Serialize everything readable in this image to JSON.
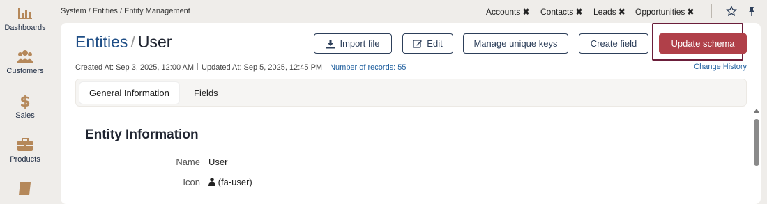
{
  "sidebar": {
    "items": [
      {
        "label": "Dashboards",
        "icon": "bar-chart-icon"
      },
      {
        "label": "Customers",
        "icon": "users-icon"
      },
      {
        "label": "Sales",
        "icon": "dollar-icon"
      },
      {
        "label": "Products",
        "icon": "briefcase-icon"
      },
      {
        "label": "",
        "icon": "book-icon"
      }
    ]
  },
  "topbar": {
    "breadcrumb": "System / Entities / Entity Management",
    "open_tabs": [
      {
        "label": "Accounts",
        "close": "✖"
      },
      {
        "label": "Contacts",
        "close": "✖"
      },
      {
        "label": "Leads",
        "close": "✖"
      },
      {
        "label": "Opportunities",
        "close": "✖"
      }
    ]
  },
  "header": {
    "title_link": "Entities",
    "title_sep": "/",
    "title_current": "User"
  },
  "actions": {
    "import": "Import file",
    "edit": "Edit",
    "unique_keys": "Manage unique keys",
    "create_field": "Create field",
    "update_schema": "Update schema"
  },
  "meta": {
    "created": "Created At: Sep 3, 2025, 12:00 AM",
    "updated": "Updated At: Sep 5, 2025, 12:45 PM",
    "records": "Number of records: 55",
    "history": "Change History"
  },
  "tabs": [
    {
      "label": "General Information",
      "active": true
    },
    {
      "label": "Fields",
      "active": false
    }
  ],
  "section": {
    "title": "Entity Information",
    "fields": [
      {
        "label": "Name",
        "value": "User"
      },
      {
        "label": "Icon",
        "value": "(fa-user)"
      }
    ]
  },
  "colors": {
    "primary": "#b04049",
    "link": "#1f4e86",
    "nav_icon": "#b5885a"
  }
}
